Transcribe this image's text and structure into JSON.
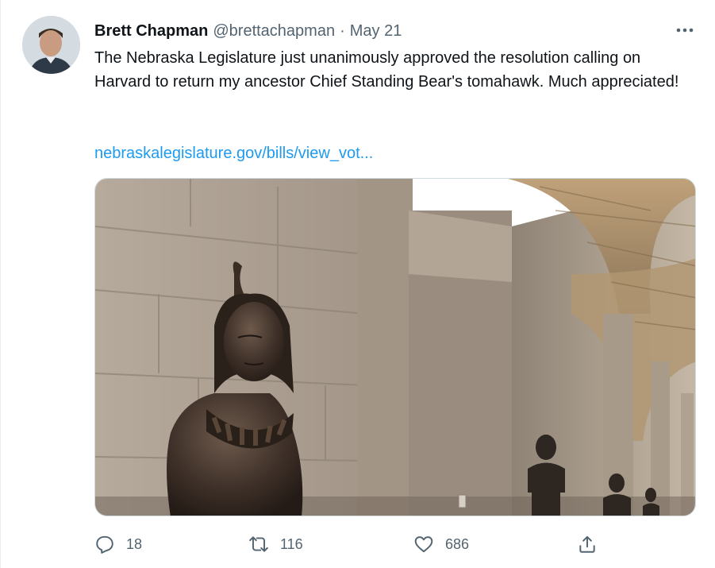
{
  "tweet": {
    "author_name": "Brett Chapman",
    "handle": "@brettachapman",
    "separator": "·",
    "date": "May 21",
    "text": "The Nebraska Legislature just unanimously approved the resolution calling on Harvard to return my ancestor Chief Standing Bear's tomahawk. Much appreciated!",
    "link_text": "nebraskalegislature.gov/bills/view_vot..."
  },
  "actions": {
    "reply_count": "18",
    "retweet_count": "116",
    "like_count": "686"
  },
  "icons": {
    "more": "more-icon",
    "reply": "reply-icon",
    "retweet": "retweet-icon",
    "like": "heart-icon",
    "share": "share-icon"
  },
  "colors": {
    "link": "#1d9bf0",
    "secondary_text": "#536471",
    "primary_text": "#0f1419"
  }
}
